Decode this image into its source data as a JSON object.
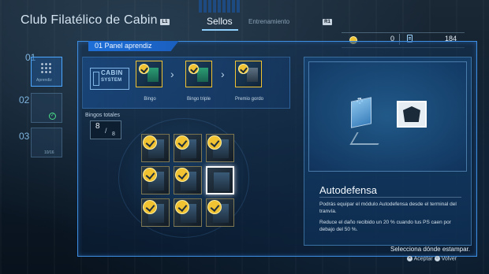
{
  "header": {
    "title": "Club Filatélico de Cabin",
    "btn_left": "L1",
    "btn_right": "R1",
    "tabs": [
      {
        "label": "Sellos",
        "active": true
      },
      {
        "label": "Entrenamiento",
        "active": false
      }
    ]
  },
  "currency": {
    "coins": "0",
    "coin_icon": "stamp-coin-icon",
    "credits": "184",
    "credit_icon": "credit-card-icon"
  },
  "nav": {
    "items": [
      {
        "number": "01",
        "caption": "Aprendiz",
        "active": true
      },
      {
        "number": "02",
        "caption": "",
        "completed": true
      },
      {
        "number": "03",
        "caption": "10/16"
      }
    ]
  },
  "panel": {
    "title": "01 Panel aprendiz",
    "logo_line1": "CABIN",
    "logo_line2": "SYSTEM",
    "rewards": [
      {
        "label": "Bingo",
        "achieved": true
      },
      {
        "label": "Bingo triple",
        "achieved": true
      },
      {
        "label": "Premio gordo",
        "achieved": true
      }
    ],
    "bingos_label": "Bingos totales",
    "bingos_count": "8",
    "bingos_total": "8"
  },
  "board": {
    "cells": [
      {
        "stamped": true
      },
      {
        "stamped": true
      },
      {
        "stamped": true
      },
      {
        "stamped": true
      },
      {
        "stamped": true
      },
      {
        "stamped": false,
        "selected": true
      },
      {
        "stamped": true
      },
      {
        "stamped": true
      },
      {
        "stamped": true
      }
    ]
  },
  "detail": {
    "name": "Autodefensa",
    "desc1": "Podrás equipar el módulo Autodefensa desde el terminal del tranvía.",
    "desc2": "Reduce el daño recibido un 20 % cuando tus PS caen por debajo del 50 %."
  },
  "footer": {
    "hint": "Selecciona dónde estampar.",
    "accept": "Aceptar",
    "back": "Volver"
  },
  "colors": {
    "accent": "#3d8ee0",
    "stamp_gold": "#f1c232"
  }
}
